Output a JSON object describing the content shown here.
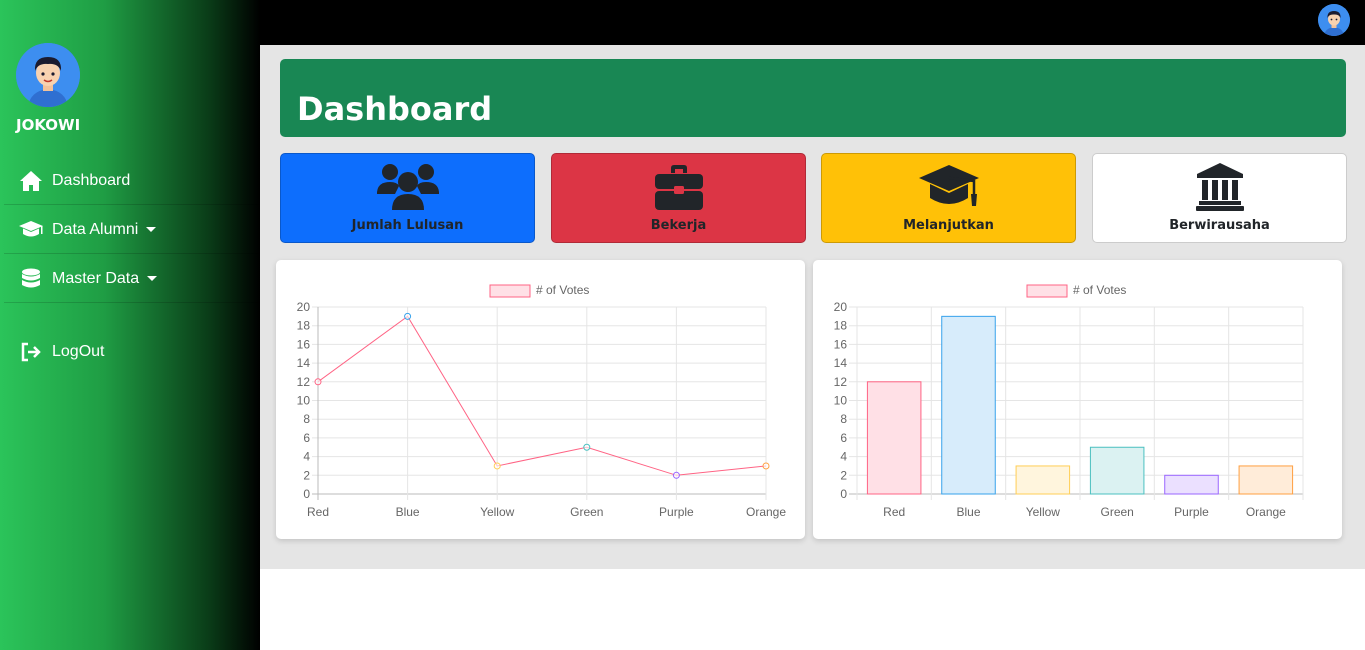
{
  "sidebar": {
    "user_name": "JOKOWI",
    "items": [
      {
        "label": "Dashboard",
        "icon": "home-icon"
      },
      {
        "label": "Data Alumni",
        "icon": "graduation-cap-icon"
      },
      {
        "label": "Master Data",
        "icon": "database-icon"
      },
      {
        "label": "LogOut",
        "icon": "logout-icon"
      }
    ]
  },
  "header": {
    "title": "Dashboard"
  },
  "stats": [
    {
      "label": "Jumlah Lulusan",
      "icon": "users-icon",
      "color": "#0d6efd"
    },
    {
      "label": "Bekerja",
      "icon": "briefcase-icon",
      "color": "#dc3545"
    },
    {
      "label": "Melanjutkan",
      "icon": "graduation-cap-icon",
      "color": "#ffc107"
    },
    {
      "label": "Berwirausaha",
      "icon": "bank-icon",
      "color": "#ffffff"
    }
  ],
  "chart_data": [
    {
      "type": "line",
      "legend": "# of Votes",
      "categories": [
        "Red",
        "Blue",
        "Yellow",
        "Green",
        "Purple",
        "Orange"
      ],
      "values": [
        12,
        19,
        3,
        5,
        2,
        3
      ],
      "ylim": [
        0,
        20
      ],
      "yticks": [
        0,
        2,
        4,
        6,
        8,
        10,
        12,
        14,
        16,
        18,
        20
      ],
      "line_color": "#ff6384",
      "point_colors": [
        "#ff6384",
        "#36a2eb",
        "#ffce56",
        "#4bc0c0",
        "#9966ff",
        "#ff9f40"
      ],
      "grid": true
    },
    {
      "type": "bar",
      "legend": "# of Votes",
      "categories": [
        "Red",
        "Blue",
        "Yellow",
        "Green",
        "Purple",
        "Orange"
      ],
      "values": [
        12,
        19,
        3,
        5,
        2,
        3
      ],
      "ylim": [
        0,
        20
      ],
      "yticks": [
        0,
        2,
        4,
        6,
        8,
        10,
        12,
        14,
        16,
        18,
        20
      ],
      "border_colors": [
        "#ff6384",
        "#36a2eb",
        "#ffce56",
        "#4bc0c0",
        "#9966ff",
        "#ff9f40"
      ],
      "fill_colors": [
        "#ffe0e6",
        "#d7ecfb",
        "#fff5dd",
        "#dbf2f2",
        "#ebe0ff",
        "#ffecd9"
      ],
      "grid": true
    }
  ]
}
